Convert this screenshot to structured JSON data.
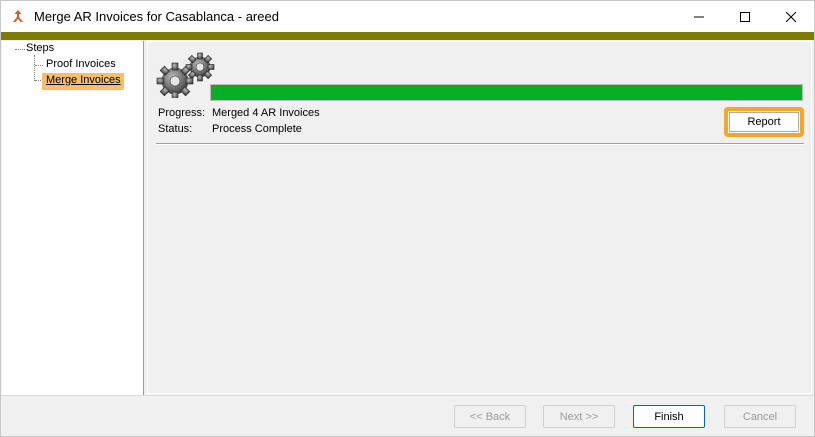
{
  "window": {
    "title": "Merge AR Invoices for Casablanca - areed",
    "app_icon": "merge-arrow-icon",
    "accent_color": "#7b7e00"
  },
  "steps": {
    "root_label": "Steps",
    "items": [
      {
        "label": "Proof Invoices",
        "selected": false
      },
      {
        "label": "Merge Invoices",
        "selected": true
      }
    ],
    "selected_color": "#f7bf6a"
  },
  "main": {
    "icon": "gears-icon",
    "progress": {
      "percent": 100,
      "color": "#06b025"
    },
    "progress_label": "Progress:",
    "progress_value": "Merged 4 AR Invoices",
    "status_label": "Status:",
    "status_value": "Process Complete",
    "report_label": "Report",
    "highlight_color": "#f5a623"
  },
  "footer": {
    "back_label": "<< Back",
    "next_label": "Next >>",
    "finish_label": "Finish",
    "cancel_label": "Cancel"
  }
}
